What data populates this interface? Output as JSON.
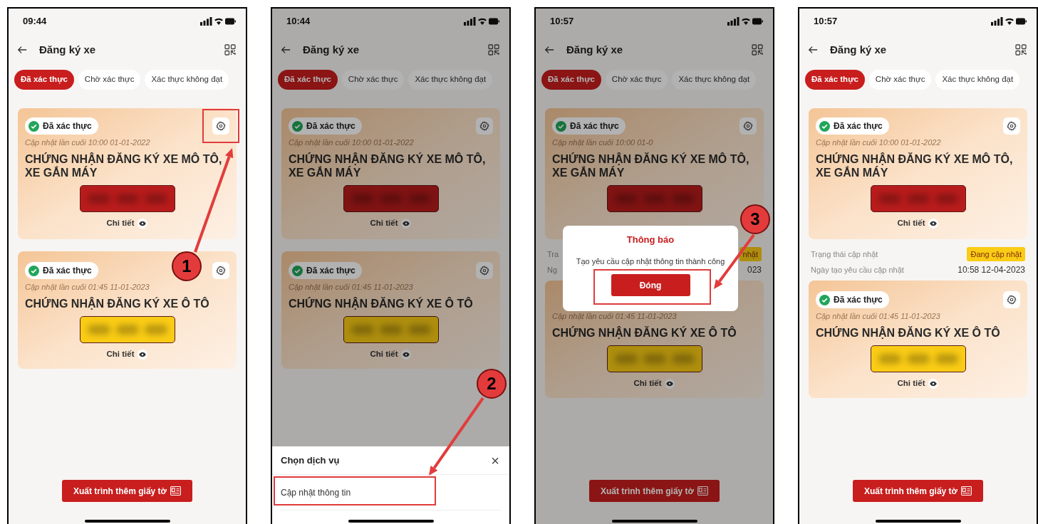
{
  "phones": [
    {
      "time": "09:44",
      "title": "Đăng ký xe",
      "tabs": [
        {
          "label": "Đã xác thực",
          "selected": true
        },
        {
          "label": "Chờ xác thực",
          "selected": false
        },
        {
          "label": "Xác thực không đạt",
          "selected": false
        }
      ],
      "cards": [
        {
          "kind": "motorbike",
          "badge": "Đã xác thực",
          "updated": "Cập nhật lần cuối 10:00 01-01-2022",
          "name": "CHỨNG NHẬN ĐĂNG KÝ XE MÔ TÔ, XE GẮN MÁY",
          "detail": "Chi tiết",
          "settings_button": true,
          "settings_highlighted": true
        },
        {
          "kind": "car",
          "badge": "Đã xác thực",
          "updated": "Cập nhật lần cuối 01:45 11-01-2023",
          "name": "CHỨNG NHẬN ĐĂNG KÝ XE Ô TÔ",
          "detail": "Chi tiết",
          "settings_button": true,
          "settings_highlighted": false
        }
      ],
      "button": "Xuất trình thêm giấy tờ",
      "step": "1"
    },
    {
      "time": "10:44",
      "title": "Đăng ký xe",
      "tabs": [
        {
          "label": "Đã xác thực",
          "selected": true
        },
        {
          "label": "Chờ xác thực",
          "selected": false
        },
        {
          "label": "Xác thực không đạt",
          "selected": false
        }
      ],
      "cards": [
        {
          "kind": "motorbike",
          "badge": "Đã xác thực",
          "updated": "Cập nhật lần cuối 10:00 01-01-2022",
          "name": "CHỨNG NHẬN ĐĂNG KÝ XE MÔ TÔ, XE GẮN MÁY",
          "detail": "Chi tiết",
          "settings_button": true,
          "settings_highlighted": false
        },
        {
          "kind": "car",
          "badge": "Đã xác thực",
          "updated": "Cập nhật lần cuối 01:45 11-01-2023",
          "name": "CHỨNG NHẬN ĐĂNG KÝ XE Ô TÔ",
          "detail": "Chi tiết",
          "settings_button": true,
          "settings_highlighted": false
        }
      ],
      "overlay": {
        "kind": "sheet",
        "title": "Chọn dịch vụ",
        "close": "×",
        "items": [
          {
            "label": "Cập nhật thông tin",
            "highlighted": true
          }
        ]
      },
      "step": "2"
    },
    {
      "time": "10:57",
      "title": "Đăng ký xe",
      "tabs": [
        {
          "label": "Đã xác thực",
          "selected": true
        },
        {
          "label": "Chờ xác thực",
          "selected": false
        },
        {
          "label": "Xác thực không đạt",
          "selected": false
        }
      ],
      "cards": [
        {
          "kind": "motorbike",
          "badge": "Đã xác thực",
          "updated": "Cập nhật lần cuối 10:00 01-0",
          "name": "CHỨNG NHẬN ĐĂNG KÝ XE MÔ TÔ, XE GẮN MÁY",
          "settings_button": true,
          "settings_highlighted": false
        },
        {
          "kind": "car",
          "updated": "Cập nhật lần cuối 01:45 11-01-2023",
          "name": "CHỨNG NHẬN ĐĂNG KÝ XE Ô TÔ",
          "detail": "Chi tiết",
          "settings_button": false,
          "settings_highlighted": false
        }
      ],
      "update_info": [
        {
          "label": "Tra",
          "value": "nhật",
          "kind": "badge"
        },
        {
          "label": "Ng",
          "value": "023",
          "kind": "text"
        }
      ],
      "button": "Xuất trình thêm giấy tờ",
      "overlay": {
        "kind": "dialog",
        "title": "Thông báo",
        "message": "Tạo yêu cầu cập nhật thông tin thành công",
        "action": "Đóng",
        "highlighted": true
      },
      "step": "3"
    },
    {
      "time": "10:57",
      "title": "Đăng ký xe",
      "tabs": [
        {
          "label": "Đã xác thực",
          "selected": true
        },
        {
          "label": "Chờ xác thực",
          "selected": false
        },
        {
          "label": "Xác thực không đạt",
          "selected": false
        }
      ],
      "cards": [
        {
          "kind": "motorbike",
          "badge": "Đã xác thực",
          "updated": "Cập nhật lần cuối 10:00 01-01-2022",
          "name": "CHỨNG NHẬN ĐĂNG KÝ XE MÔ TÔ, XE GẮN MÁY",
          "detail": "Chi tiết",
          "settings_button": true,
          "settings_highlighted": false
        },
        {
          "kind": "car",
          "badge": "Đã xác thực",
          "updated": "Cập nhật lần cuối 01:45 11-01-2023",
          "name": "CHỨNG NHẬN ĐĂNG KÝ XE Ô TÔ",
          "detail": "Chi tiết",
          "settings_button": true,
          "settings_highlighted": false
        }
      ],
      "update_info": [
        {
          "label": "Trạng thái cập nhật",
          "value": "Đang cập nhật",
          "kind": "badge"
        },
        {
          "label": "Ngày tạo yêu cầu cập nhật",
          "value": "10:58 12-04-2023",
          "kind": "text"
        }
      ],
      "button": "Xuất trình thêm giấy tờ"
    }
  ]
}
